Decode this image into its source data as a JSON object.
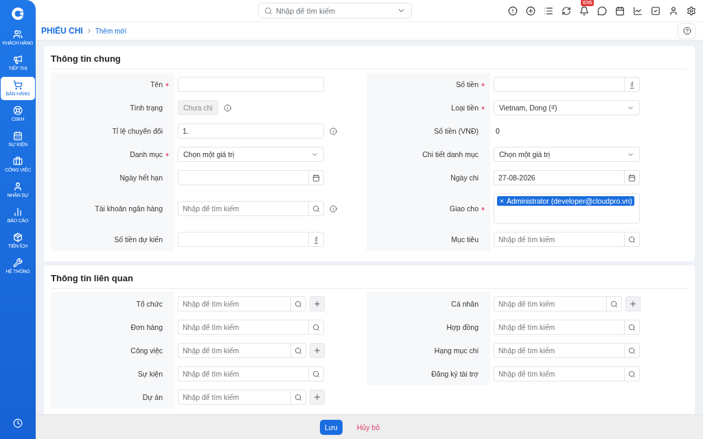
{
  "sidebar": {
    "items": [
      {
        "label": "KHÁCH HÀNG",
        "selected": false
      },
      {
        "label": "TIẾP THỊ",
        "selected": false
      },
      {
        "label": "BÁN HÀNG",
        "selected": true
      },
      {
        "label": "CSKH",
        "selected": false
      },
      {
        "label": "SỰ KIỆN",
        "selected": false
      },
      {
        "label": "CÔNG VIỆC",
        "selected": false
      },
      {
        "label": "NHÂN SỰ",
        "selected": false
      },
      {
        "label": "BÁO CÁO",
        "selected": false
      },
      {
        "label": "TIỆN ÍCH",
        "selected": false
      },
      {
        "label": "HỆ THỐNG",
        "selected": false
      }
    ]
  },
  "topbar": {
    "search": {
      "placeholder": "Nhập để tìm kiếm"
    },
    "notification_count": "696"
  },
  "breadcrumb": {
    "module": "PHIẾU CHI",
    "page": "Thêm mới"
  },
  "sections": [
    {
      "title": "Thông tin chung",
      "rows": [
        {
          "left": {
            "label": "Tên",
            "required": true,
            "info": false,
            "kind": "text"
          },
          "right": {
            "label": "Số tiền",
            "required": true,
            "info": false,
            "kind": "currency",
            "suffix": "₫"
          }
        },
        {
          "left": {
            "label": "Tình trạng",
            "required": false,
            "info": true,
            "kind": "status",
            "value": "Chưa chi"
          },
          "right": {
            "label": "Loại tiền",
            "required": true,
            "info": false,
            "kind": "select",
            "value": "Vietnam, Dong (₫)"
          }
        },
        {
          "left": {
            "label": "Tỉ lệ chuyển đổi",
            "required": false,
            "info": true,
            "kind": "text",
            "value": "1."
          },
          "right": {
            "label": "Số tiền (VNĐ)",
            "required": false,
            "info": false,
            "kind": "value",
            "value": "0"
          }
        },
        {
          "left": {
            "label": "Danh mục",
            "required": true,
            "info": false,
            "kind": "select",
            "value": "Chọn một giá trị"
          },
          "right": {
            "label": "Chi tiết danh mục",
            "required": false,
            "info": false,
            "kind": "select",
            "value": "Chọn một giá trị"
          }
        },
        {
          "left": {
            "label": "Ngày hết hạn",
            "required": false,
            "info": false,
            "kind": "date"
          },
          "right": {
            "label": "Ngày chi",
            "required": false,
            "info": false,
            "kind": "date",
            "value": "27-08-2026"
          }
        },
        {
          "left": {
            "label": "Tài khoản ngân hàng",
            "required": false,
            "info": true,
            "kind": "search",
            "placeholder": "Nhập để tìm kiếm"
          },
          "right": {
            "label": "Giao cho",
            "required": true,
            "info": false,
            "kind": "tags",
            "tags": [
              "Administrator (developer@cloudpro.vn)"
            ]
          }
        },
        {
          "left": {
            "label": "Số tiền dự kiến",
            "required": false,
            "info": false,
            "kind": "currency",
            "suffix": "₫"
          },
          "right": {
            "label": "Mục tiêu",
            "required": false,
            "info": false,
            "kind": "search",
            "placeholder": "Nhập để tìm kiếm"
          }
        }
      ]
    },
    {
      "title": "Thông tin liên quan",
      "rows": [
        {
          "left": {
            "label": "Tổ chức",
            "required": false,
            "info": false,
            "kind": "search_add",
            "placeholder": "Nhập để tìm kiếm"
          },
          "right": {
            "label": "Cá nhân",
            "required": false,
            "info": false,
            "kind": "search_add",
            "placeholder": "Nhập để tìm kiếm"
          }
        },
        {
          "left": {
            "label": "Đơn hàng",
            "required": false,
            "info": false,
            "kind": "search",
            "placeholder": "Nhập để tìm kiếm"
          },
          "right": {
            "label": "Hợp đồng",
            "required": false,
            "info": false,
            "kind": "search",
            "placeholder": "Nhập để tìm kiếm"
          }
        },
        {
          "left": {
            "label": "Công việc",
            "required": false,
            "info": false,
            "kind": "search_add",
            "placeholder": "Nhập để tìm kiếm"
          },
          "right": {
            "label": "Hạng mục chi",
            "required": false,
            "info": false,
            "kind": "search",
            "placeholder": "Nhập để tìm kiếm"
          }
        },
        {
          "left": {
            "label": "Sự kiện",
            "required": false,
            "info": false,
            "kind": "search",
            "placeholder": "Nhập để tìm kiếm"
          },
          "right": {
            "label": "Đăng ký tài trợ",
            "required": false,
            "info": false,
            "kind": "search",
            "placeholder": "Nhập để tìm kiếm"
          }
        },
        {
          "left": {
            "label": "Dự án",
            "required": false,
            "info": false,
            "kind": "search_add",
            "placeholder": "Nhập để tìm kiếm"
          }
        }
      ]
    }
  ],
  "footer": {
    "buttons": [
      {
        "label": "Lưu",
        "kind": "primary"
      },
      {
        "label": "Hủy bỏ",
        "kind": "link"
      }
    ]
  }
}
